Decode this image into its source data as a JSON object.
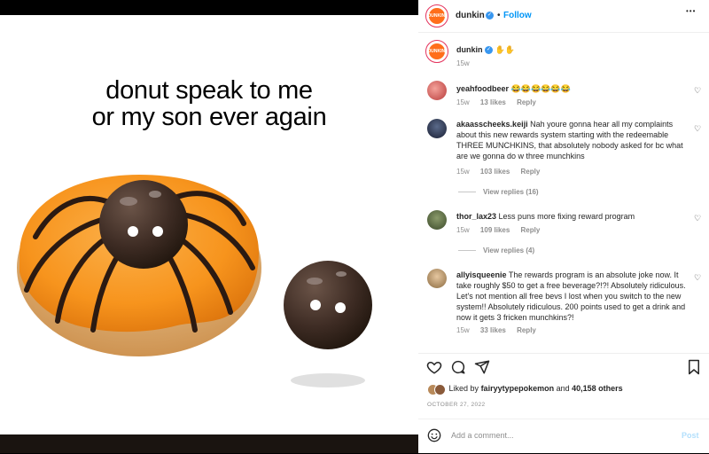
{
  "post": {
    "image_text_line1": "donut speak to me",
    "image_text_line2": "or my son ever again"
  },
  "header": {
    "username": "dunkin",
    "avatar_label": "DUNKIN'",
    "separator": "•",
    "follow_label": "Follow",
    "more_label": "•••"
  },
  "caption": {
    "username": "dunkin",
    "text": "✋✋",
    "time": "15w"
  },
  "comments": [
    {
      "username": "yeahfoodbeer",
      "text": "😂😂😂😂😂😂",
      "time": "15w",
      "likes": "13 likes",
      "reply": "Reply"
    },
    {
      "username": "akaasscheeks.keiji",
      "text": "Nah youre gonna hear all my complaints about this new rewards system starting with the redeemable THREE MUNCHKINS, that absolutely nobody asked for bc what are we gonna do w three munchkins",
      "time": "15w",
      "likes": "103 likes",
      "reply": "Reply",
      "view_replies": "View replies (16)"
    },
    {
      "username": "thor_lax23",
      "text": "Less puns more fixing reward program",
      "time": "15w",
      "likes": "109 likes",
      "reply": "Reply",
      "view_replies": "View replies (4)"
    },
    {
      "username": "allyisqueenie",
      "text": "The rewards program is an absolute joke now. It take roughly $50 to get a free beverage?!?! Absolutely ridiculous. Let's not mention all free bevs I lost when you switch to the new system!! Absolutely ridiculous. 200 points used to get a drink and now it gets 3 fricken munchkins?!",
      "time": "15w",
      "likes": "33 likes",
      "reply": "Reply"
    }
  ],
  "likes": {
    "prefix": "Liked by",
    "user": "fairyytypepokemon",
    "and": "and",
    "others": "40,158 others"
  },
  "date": "OCTOBER 27, 2022",
  "add_comment": {
    "placeholder": "Add a comment...",
    "post_label": "Post"
  },
  "colors": {
    "follow": "#0095f6",
    "verified": "#3897f0",
    "brand_orange": "#ff6e1b",
    "icing": "#f7941d"
  }
}
